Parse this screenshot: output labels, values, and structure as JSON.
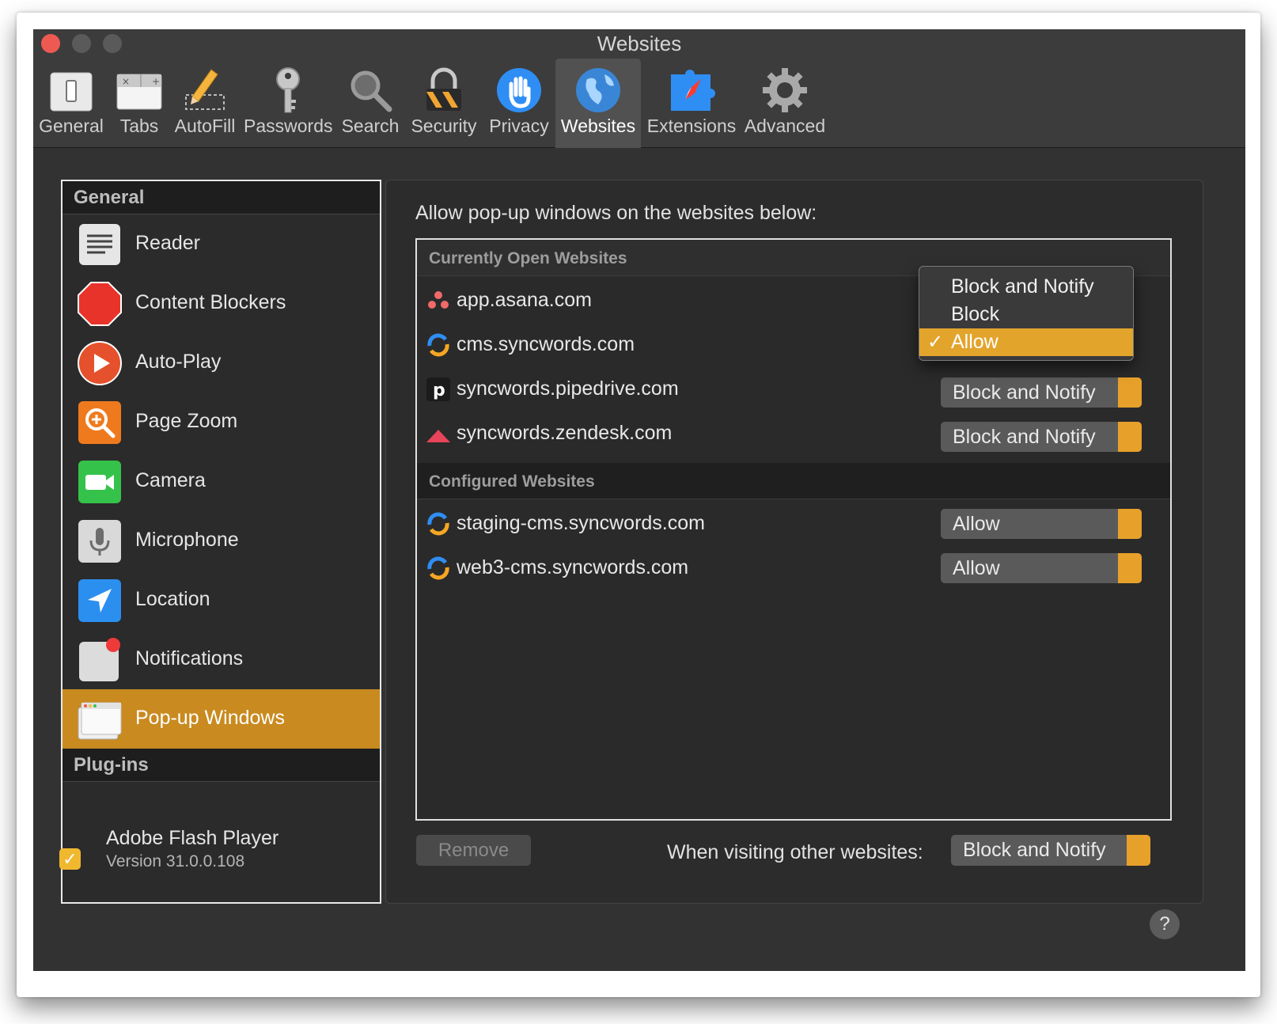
{
  "window": {
    "title": "Websites"
  },
  "toolbar": {
    "items": [
      {
        "label": "General",
        "icon": "general-switch-icon"
      },
      {
        "label": "Tabs",
        "icon": "tabs-icon"
      },
      {
        "label": "AutoFill",
        "icon": "pencil-icon"
      },
      {
        "label": "Passwords",
        "icon": "key-icon"
      },
      {
        "label": "Search",
        "icon": "magnifier-icon"
      },
      {
        "label": "Security",
        "icon": "lock-icon"
      },
      {
        "label": "Privacy",
        "icon": "hand-icon"
      },
      {
        "label": "Websites",
        "icon": "globe-icon",
        "active": true
      },
      {
        "label": "Extensions",
        "icon": "puzzle-compass-icon"
      },
      {
        "label": "Advanced",
        "icon": "gear-icon"
      }
    ]
  },
  "sidebar": {
    "general_header": "General",
    "items": [
      {
        "label": "Reader",
        "icon": "reader-icon"
      },
      {
        "label": "Content Blockers",
        "icon": "stop-sign-icon"
      },
      {
        "label": "Auto-Play",
        "icon": "play-icon"
      },
      {
        "label": "Page Zoom",
        "icon": "zoom-icon"
      },
      {
        "label": "Camera",
        "icon": "camera-icon"
      },
      {
        "label": "Microphone",
        "icon": "microphone-icon"
      },
      {
        "label": "Location",
        "icon": "location-arrow-icon"
      },
      {
        "label": "Notifications",
        "icon": "notifications-icon"
      },
      {
        "label": "Pop-up Windows",
        "icon": "popup-windows-icon",
        "selected": true
      }
    ],
    "plugins_header": "Plug-ins",
    "plugin": {
      "name": "Adobe Flash Player",
      "version": "Version 31.0.0.108",
      "checked": true
    }
  },
  "main": {
    "heading": "Allow pop-up windows on the websites below:",
    "current_header": "Currently Open Websites",
    "current_sites": [
      {
        "name": "app.asana.com",
        "icon": "asana-icon",
        "setting": "Block and Notify"
      },
      {
        "name": "cms.syncwords.com",
        "icon": "syncwords-icon",
        "setting": "Allow"
      },
      {
        "name": "syncwords.pipedrive.com",
        "icon": "pipedrive-icon",
        "setting": "Block and Notify"
      },
      {
        "name": "syncwords.zendesk.com",
        "icon": "zendesk-icon",
        "setting": "Block and Notify"
      }
    ],
    "configured_header": "Configured Websites",
    "configured_sites": [
      {
        "name": "staging-cms.syncwords.com",
        "icon": "syncwords-icon",
        "setting": "Allow"
      },
      {
        "name": "web3-cms.syncwords.com",
        "icon": "syncwords-icon",
        "setting": "Allow"
      }
    ],
    "open_menu": {
      "options": [
        "Block and Notify",
        "Block",
        "Allow"
      ],
      "selected": "Allow"
    },
    "remove_button": "Remove",
    "visiting_label": "When visiting other websites:",
    "default_setting": "Block and Notify",
    "help_label": "?"
  },
  "colors": {
    "accent": "#E3A42C",
    "selection": "#C98A1F",
    "close": "#EE5A52"
  }
}
